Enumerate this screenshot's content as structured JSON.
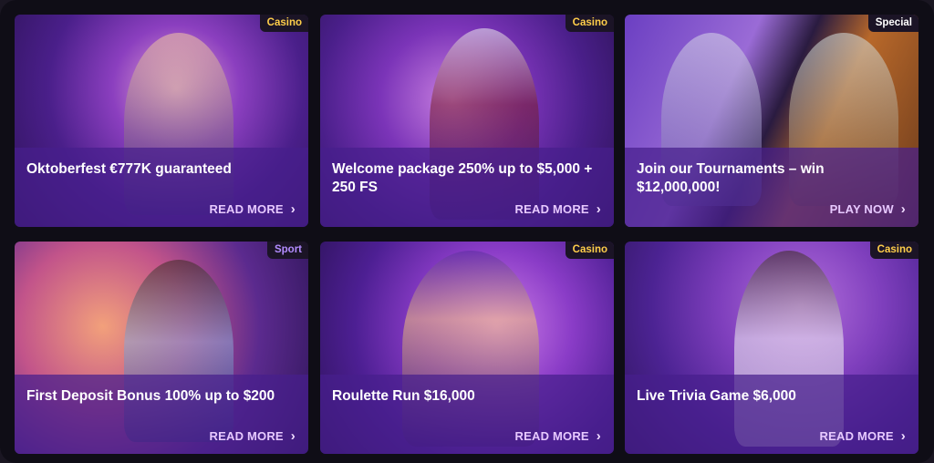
{
  "cards": [
    {
      "badge": "Casino",
      "title": "Oktoberfest €777K guaranteed",
      "cta": "READ MORE"
    },
    {
      "badge": "Casino",
      "title": "Welcome package 250% up to $5,000 + 250 FS",
      "cta": "READ MORE"
    },
    {
      "badge": "Special",
      "title": "Join our Tournaments – win $12,000,000!",
      "cta": "PLAY NOW"
    },
    {
      "badge": "Sport",
      "title": "First Deposit Bonus 100% up to $200",
      "cta": "READ MORE"
    },
    {
      "badge": "Casino",
      "title": "Roulette Run $16,000",
      "cta": "READ MORE"
    },
    {
      "badge": "Casino",
      "title": "Live Trivia Game $6,000",
      "cta": "READ MORE"
    }
  ],
  "icons": {
    "cta": "chevron-right-icon"
  },
  "colors": {
    "badge_casino": "#ffce4a",
    "badge_sport": "#b38cff",
    "badge_special": "#ffffff"
  }
}
